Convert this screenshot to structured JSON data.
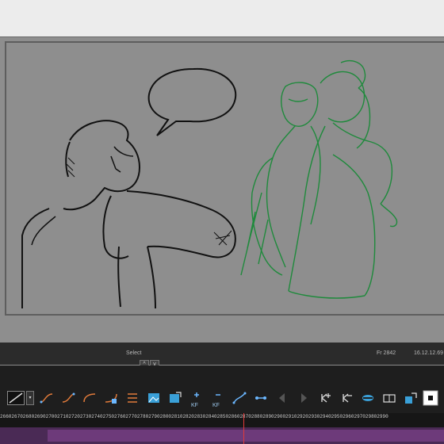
{
  "status": {
    "selection_label": "Select",
    "frame_label": "Fr 2842",
    "timecode": "16.12.12.69"
  },
  "nav": {
    "up": "^",
    "down": "v"
  },
  "toolbar": {
    "keyframe_label": "KF",
    "tools": [
      "line-style-preview",
      "line-style-dropdown",
      "curve-in-icon",
      "curve-out-icon",
      "ease-in-icon",
      "ease-out-icon",
      "flip-icon",
      "image-icon",
      "image-edit-icon",
      "add-keyframe-icon",
      "remove-keyframe-icon",
      "motion-path-icon",
      "link-keys-icon",
      "previous-key-icon",
      "next-key-icon",
      "key-plus-icon",
      "key-minus-icon",
      "camera-icon",
      "film-icon",
      "export-icon",
      "stop-icon"
    ]
  },
  "ruler": {
    "labels": "2660267026802690270027102720273027402750276027702780279028002810282028302840285028602870288028902900291029202930294029502960297029802990"
  }
}
